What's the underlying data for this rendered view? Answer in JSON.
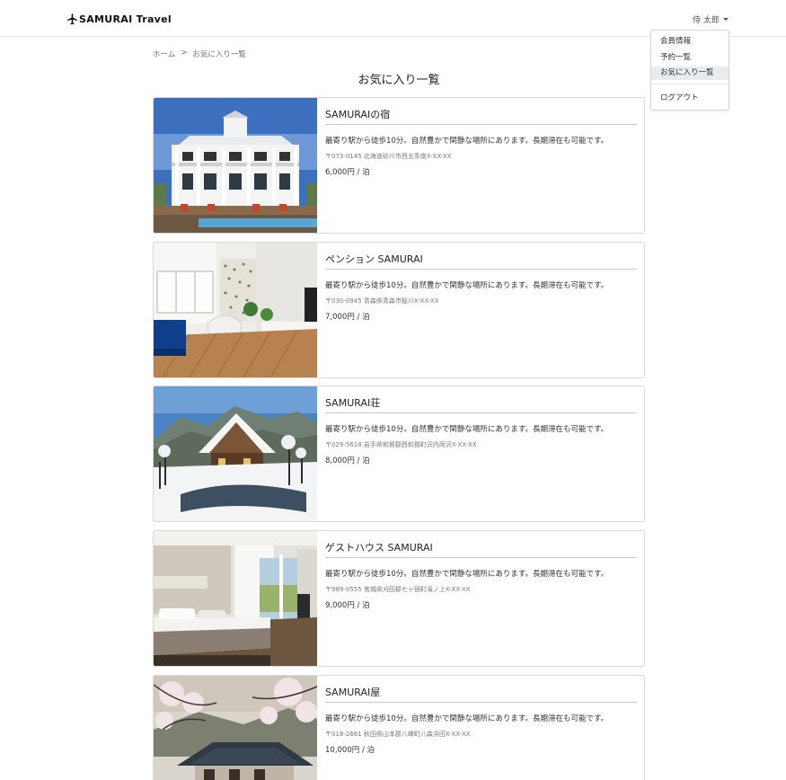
{
  "header": {
    "brand": "SAMURAI Travel",
    "brand_icon": "airplane-icon",
    "user_name": "侍 太郎"
  },
  "user_menu": {
    "items": [
      {
        "label": "会員情報"
      },
      {
        "label": "予約一覧"
      },
      {
        "label": "お気に入り一覧",
        "active": true
      },
      {
        "label": "ログアウト"
      }
    ]
  },
  "breadcrumb": {
    "home": "ホーム",
    "separator": ">",
    "current": "お気に入り一覧"
  },
  "page": {
    "title": "お気に入り一覧"
  },
  "favorites": [
    {
      "name": "SAMURAIの宿",
      "description": "最寄り駅から徒歩10分。自然豊かで閑静な場所にあります。長期滞在も可能です。",
      "address": "〒073-0145 北海道砂川市西五条南X-XX-XX",
      "price": "6,000円 / 泊"
    },
    {
      "name": "ペンション SAMURAI",
      "description": "最寄り駅から徒歩10分。自然豊かで閑静な場所にあります。長期滞在も可能です。",
      "address": "〒030-0945 青森県青森市桜川X-XX-XX",
      "price": "7,000円 / 泊"
    },
    {
      "name": "SAMURAI荘",
      "description": "最寄り駅から徒歩10分。自然豊かで閑静な場所にあります。長期滞在も可能です。",
      "address": "〒029-5618 岩手県和賀郡西和賀町沢内両沢X-XX-XX",
      "price": "8,000円 / 泊"
    },
    {
      "name": "ゲストハウス SAMURAI",
      "description": "最寄り駅から徒歩10分。自然豊かで閑静な場所にあります。長期滞在も可能です。",
      "address": "〒989-0555 宮城県刈田郡七ヶ宿町滝ノ上X-XX-XX",
      "price": "9,000円 / 泊"
    },
    {
      "name": "SAMURAI屋",
      "description": "最寄り駅から徒歩10分。自然豊かで閑静な場所にあります。長期滞在も可能です。",
      "address": "〒018-2661 秋田県山本郡八峰町八森浜田X-XX-XX",
      "price": "10,000円 / 泊"
    }
  ]
}
